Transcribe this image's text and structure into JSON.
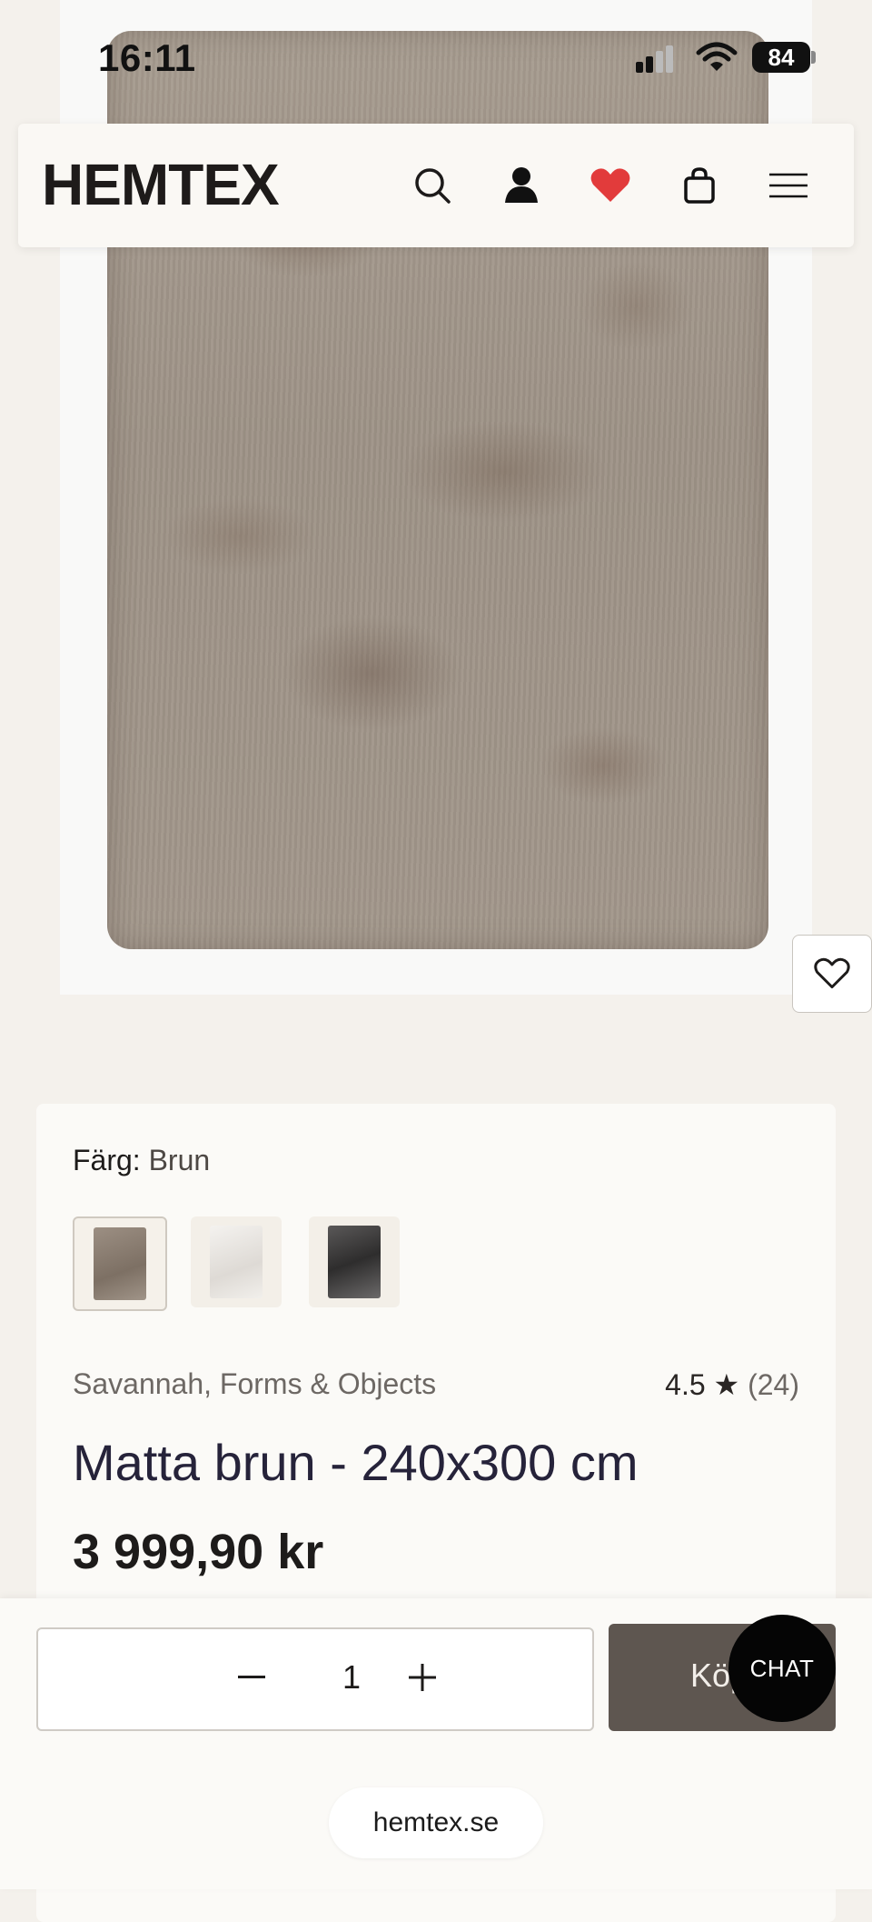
{
  "status_bar": {
    "time": "16:11",
    "battery": "84"
  },
  "header": {
    "logo": "HEMTEX",
    "icons": [
      "search-icon",
      "account-icon",
      "heart-icon",
      "bag-icon",
      "menu-icon"
    ],
    "favorite_color": "#e23b3b"
  },
  "product": {
    "color_label": "Färg:",
    "color_value": "Brun",
    "swatches": [
      "Brun",
      "Vit",
      "Grå"
    ],
    "brand": "Savannah, Forms & Objects",
    "rating_value": "4.5",
    "rating_star": "★",
    "rating_count": "(24)",
    "title": "Matta brun - 240x300 cm",
    "price": "3 999,90 kr"
  },
  "cart": {
    "quantity": "1",
    "buy_label": "Köp",
    "chat_label": "CHAT"
  },
  "browser": {
    "url": "hemtex.se"
  }
}
